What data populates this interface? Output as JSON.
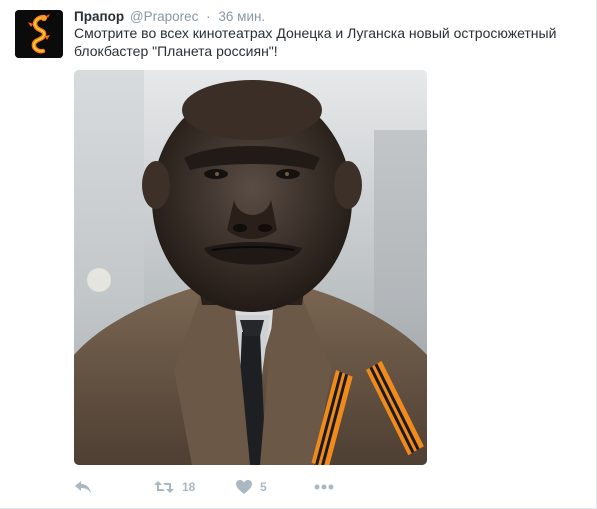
{
  "tweet": {
    "fullname": "Прапор",
    "username": "@Praporec",
    "separator": "·",
    "timestamp": "36 мин.",
    "text_line1": "Смотрите во всех кинотеатрах Донецка и Луганска новый остросюжетный",
    "text_line2": "блокбастер \"Планета россиян\"!"
  },
  "actions": {
    "reply_icon": "reply-icon",
    "retweet_icon": "retweet-icon",
    "retweet_count": "18",
    "like_icon": "heart-icon",
    "like_count": "5",
    "more_icon": "more-dots-icon"
  },
  "colors": {
    "text": "#292f33",
    "muted": "#8899a6",
    "icon": "#aab8c2",
    "border": "#e1e8ed"
  }
}
